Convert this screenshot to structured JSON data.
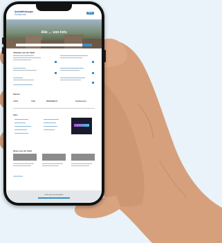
{
  "site": {
    "logo_line1": "Aschaffenburger",
    "logo_line2": "Stadtportal",
    "menu_label": "Menu",
    "hero_title": "Alle ... von Info",
    "search_placeholder": "",
    "search_button": ""
  },
  "sections": {
    "news_title": "Aktuelles aus der Stadt",
    "partners_title": "Partner",
    "info_title": "Infos",
    "blog_title": "Neues aus der Stadt",
    "footer_text": "Jetzt App herunterladen"
  },
  "partners": [
    "AWO",
    "VHS",
    "WOHNBAU",
    "Stadtwerke"
  ],
  "colors": {
    "accent": "#3a8fc4",
    "phone_frame": "#121212",
    "background": "#e9f3f9",
    "skin": "#d39a77"
  },
  "icons": [
    "hand-illustration",
    "smartphone"
  ]
}
